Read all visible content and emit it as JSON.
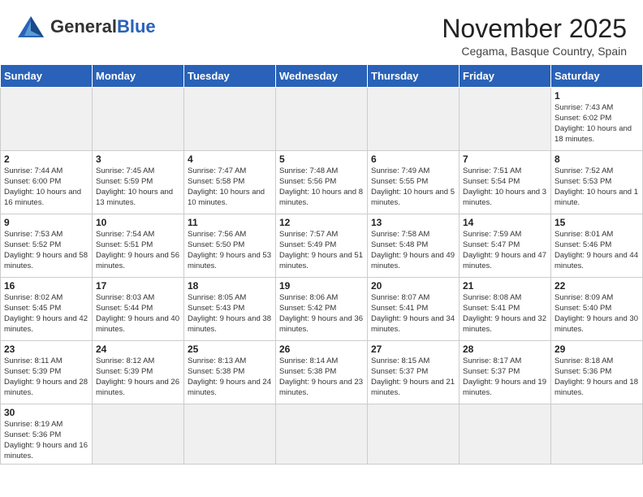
{
  "header": {
    "logo_general": "General",
    "logo_blue": "Blue",
    "month_title": "November 2025",
    "subtitle": "Cegama, Basque Country, Spain"
  },
  "weekdays": [
    "Sunday",
    "Monday",
    "Tuesday",
    "Wednesday",
    "Thursday",
    "Friday",
    "Saturday"
  ],
  "weeks": [
    [
      {
        "day": "",
        "info": "",
        "empty": true
      },
      {
        "day": "",
        "info": "",
        "empty": true
      },
      {
        "day": "",
        "info": "",
        "empty": true
      },
      {
        "day": "",
        "info": "",
        "empty": true
      },
      {
        "day": "",
        "info": "",
        "empty": true
      },
      {
        "day": "",
        "info": "",
        "empty": true
      },
      {
        "day": "1",
        "info": "Sunrise: 7:43 AM\nSunset: 6:02 PM\nDaylight: 10 hours and 18 minutes."
      }
    ],
    [
      {
        "day": "2",
        "info": "Sunrise: 7:44 AM\nSunset: 6:00 PM\nDaylight: 10 hours and 16 minutes."
      },
      {
        "day": "3",
        "info": "Sunrise: 7:45 AM\nSunset: 5:59 PM\nDaylight: 10 hours and 13 minutes."
      },
      {
        "day": "4",
        "info": "Sunrise: 7:47 AM\nSunset: 5:58 PM\nDaylight: 10 hours and 10 minutes."
      },
      {
        "day": "5",
        "info": "Sunrise: 7:48 AM\nSunset: 5:56 PM\nDaylight: 10 hours and 8 minutes."
      },
      {
        "day": "6",
        "info": "Sunrise: 7:49 AM\nSunset: 5:55 PM\nDaylight: 10 hours and 5 minutes."
      },
      {
        "day": "7",
        "info": "Sunrise: 7:51 AM\nSunset: 5:54 PM\nDaylight: 10 hours and 3 minutes."
      },
      {
        "day": "8",
        "info": "Sunrise: 7:52 AM\nSunset: 5:53 PM\nDaylight: 10 hours and 1 minute."
      }
    ],
    [
      {
        "day": "9",
        "info": "Sunrise: 7:53 AM\nSunset: 5:52 PM\nDaylight: 9 hours and 58 minutes."
      },
      {
        "day": "10",
        "info": "Sunrise: 7:54 AM\nSunset: 5:51 PM\nDaylight: 9 hours and 56 minutes."
      },
      {
        "day": "11",
        "info": "Sunrise: 7:56 AM\nSunset: 5:50 PM\nDaylight: 9 hours and 53 minutes."
      },
      {
        "day": "12",
        "info": "Sunrise: 7:57 AM\nSunset: 5:49 PM\nDaylight: 9 hours and 51 minutes."
      },
      {
        "day": "13",
        "info": "Sunrise: 7:58 AM\nSunset: 5:48 PM\nDaylight: 9 hours and 49 minutes."
      },
      {
        "day": "14",
        "info": "Sunrise: 7:59 AM\nSunset: 5:47 PM\nDaylight: 9 hours and 47 minutes."
      },
      {
        "day": "15",
        "info": "Sunrise: 8:01 AM\nSunset: 5:46 PM\nDaylight: 9 hours and 44 minutes."
      }
    ],
    [
      {
        "day": "16",
        "info": "Sunrise: 8:02 AM\nSunset: 5:45 PM\nDaylight: 9 hours and 42 minutes."
      },
      {
        "day": "17",
        "info": "Sunrise: 8:03 AM\nSunset: 5:44 PM\nDaylight: 9 hours and 40 minutes."
      },
      {
        "day": "18",
        "info": "Sunrise: 8:05 AM\nSunset: 5:43 PM\nDaylight: 9 hours and 38 minutes."
      },
      {
        "day": "19",
        "info": "Sunrise: 8:06 AM\nSunset: 5:42 PM\nDaylight: 9 hours and 36 minutes."
      },
      {
        "day": "20",
        "info": "Sunrise: 8:07 AM\nSunset: 5:41 PM\nDaylight: 9 hours and 34 minutes."
      },
      {
        "day": "21",
        "info": "Sunrise: 8:08 AM\nSunset: 5:41 PM\nDaylight: 9 hours and 32 minutes."
      },
      {
        "day": "22",
        "info": "Sunrise: 8:09 AM\nSunset: 5:40 PM\nDaylight: 9 hours and 30 minutes."
      }
    ],
    [
      {
        "day": "23",
        "info": "Sunrise: 8:11 AM\nSunset: 5:39 PM\nDaylight: 9 hours and 28 minutes."
      },
      {
        "day": "24",
        "info": "Sunrise: 8:12 AM\nSunset: 5:39 PM\nDaylight: 9 hours and 26 minutes."
      },
      {
        "day": "25",
        "info": "Sunrise: 8:13 AM\nSunset: 5:38 PM\nDaylight: 9 hours and 24 minutes."
      },
      {
        "day": "26",
        "info": "Sunrise: 8:14 AM\nSunset: 5:38 PM\nDaylight: 9 hours and 23 minutes."
      },
      {
        "day": "27",
        "info": "Sunrise: 8:15 AM\nSunset: 5:37 PM\nDaylight: 9 hours and 21 minutes."
      },
      {
        "day": "28",
        "info": "Sunrise: 8:17 AM\nSunset: 5:37 PM\nDaylight: 9 hours and 19 minutes."
      },
      {
        "day": "29",
        "info": "Sunrise: 8:18 AM\nSunset: 5:36 PM\nDaylight: 9 hours and 18 minutes."
      }
    ],
    [
      {
        "day": "30",
        "info": "Sunrise: 8:19 AM\nSunset: 5:36 PM\nDaylight: 9 hours and 16 minutes.",
        "last": true
      },
      {
        "day": "",
        "info": "",
        "empty": true,
        "last": true
      },
      {
        "day": "",
        "info": "",
        "empty": true,
        "last": true
      },
      {
        "day": "",
        "info": "",
        "empty": true,
        "last": true
      },
      {
        "day": "",
        "info": "",
        "empty": true,
        "last": true
      },
      {
        "day": "",
        "info": "",
        "empty": true,
        "last": true
      },
      {
        "day": "",
        "info": "",
        "empty": true,
        "last": true
      }
    ]
  ]
}
